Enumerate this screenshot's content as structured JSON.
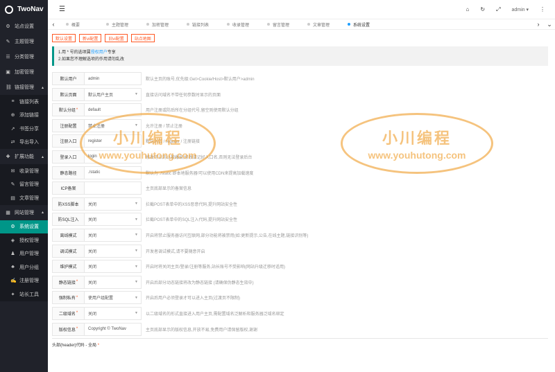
{
  "app": {
    "name": "TwoNav"
  },
  "header": {
    "user": "admin ▾"
  },
  "sidebar": {
    "items": [
      {
        "label": "站点设置",
        "icon": "gear-icon",
        "glyph": "⚙"
      },
      {
        "label": "主题管理",
        "icon": "brush-icon",
        "glyph": "✎"
      },
      {
        "label": "分类管理",
        "icon": "list-icon",
        "glyph": "☰"
      },
      {
        "label": "加密管理",
        "icon": "lock-icon",
        "glyph": "▣"
      },
      {
        "label": "链接管理",
        "icon": "link-icon",
        "glyph": "⛓"
      },
      {
        "label": "链接列表",
        "icon": "list-icon",
        "glyph": "≡"
      },
      {
        "label": "添加链接",
        "icon": "plus-icon",
        "glyph": "⊕"
      },
      {
        "label": "书签分享",
        "icon": "share-icon",
        "glyph": "↗"
      },
      {
        "label": "导出导入",
        "icon": "import-icon",
        "glyph": "⇄"
      },
      {
        "label": "扩展功能",
        "icon": "puzzle-icon",
        "glyph": "✚"
      },
      {
        "label": "收录管理",
        "icon": "inbox-icon",
        "glyph": "✉"
      },
      {
        "label": "留言管理",
        "icon": "message-icon",
        "glyph": "✎"
      },
      {
        "label": "文章管理",
        "icon": "document-icon",
        "glyph": "▤"
      },
      {
        "label": "网站管理",
        "icon": "site-icon",
        "glyph": "▦"
      },
      {
        "label": "系统设置",
        "icon": "settings-icon",
        "glyph": "⚙"
      },
      {
        "label": "授权管理",
        "icon": "key-icon",
        "glyph": "◈"
      },
      {
        "label": "用户管理",
        "icon": "user-icon",
        "glyph": "♟"
      },
      {
        "label": "用户分组",
        "icon": "group-icon",
        "glyph": "♣"
      },
      {
        "label": "注册管理",
        "icon": "register-icon",
        "glyph": "✍"
      },
      {
        "label": "站长工具",
        "icon": "tool-icon",
        "glyph": "✦"
      }
    ]
  },
  "tabs": [
    "概要",
    "主题管理",
    "加密管理",
    "链接列表",
    "收录管理",
    "留言管理",
    "文章管理",
    "系统设置"
  ],
  "buttons": {
    "default": "默认设置",
    "new": "新vi配置",
    "old": "旧vi配置",
    "export": "站点地图"
  },
  "notice": {
    "line1_prefix": "1.用 * 号的选项属",
    "line1_link": "授权用户",
    "line1_suffix": "专享",
    "line2": "2.如果您不理解选项的作用请勿乱改"
  },
  "rows": [
    {
      "label": "默认用户",
      "value": "admin",
      "select": false,
      "required": false,
      "desc": "默认主页的账号,优先级:Get>Cookie/Host>默认用户>admin"
    },
    {
      "label": "默认页面",
      "value": "默认用户主页",
      "select": true,
      "required": false,
      "desc": "直接访问域名不带任何参数时显示的页面"
    },
    {
      "label": "默认分组",
      "value": "default",
      "select": false,
      "required": true,
      "desc": "用户注册或防后所在分组代号,留空则使用默认分组"
    },
    {
      "label": "注册配置",
      "value": "禁止注册",
      "select": true,
      "required": false,
      "desc": "允许注册 / 禁止注册"
    },
    {
      "label": "注册入口",
      "value": "register",
      "select": false,
      "required": false,
      "desc": "默认入口 / register / 注册链接"
    },
    {
      "label": "登录入口",
      "value": "login",
      "select": false,
      "required": false,
      "desc": "修改可以防止被爆破,修改请记好入口名,否则无法登录后台"
    },
    {
      "label": "静态路径",
      "value": "./static",
      "select": false,
      "required": false,
      "desc": "默认为 ./static 即本地服务器!可以使用CDN来提高加载速度"
    },
    {
      "label": "ICP备案",
      "value": "",
      "select": false,
      "required": false,
      "desc": "主页底部显示的备案信息"
    },
    {
      "label": "防XSS脚本",
      "value": "关闭",
      "select": true,
      "required": false,
      "desc": "拦截POST表单中的XSS恶意代码,提升网站安全性"
    },
    {
      "label": "防SQL注入",
      "value": "关闭",
      "select": true,
      "required": false,
      "desc": "拦截POST表单中的SQL注入代码,提升网站安全性"
    },
    {
      "label": "离线模式",
      "value": "关闭",
      "select": true,
      "required": false,
      "desc": "开启将禁止服务器访问互联网,部分功能将被禁用(如:更新提示,公告,在线主题,链接识别等)"
    },
    {
      "label": "调试模式",
      "value": "关闭",
      "select": true,
      "required": false,
      "desc": "开发者调试模式,请不要随意开启"
    },
    {
      "label": "维护模式",
      "value": "关闭",
      "select": true,
      "required": false,
      "desc": "开启时将关闭主页/登录/注册等服务,站长账号不受影响(网站升级迁移时适用)"
    },
    {
      "label": "静态链接",
      "value": "关闭",
      "select": true,
      "required": true,
      "desc": "开启后部分动态链接将改为静态链接 (请确保伪静态生效中)"
    },
    {
      "label": "强制私有",
      "value": "使用户组配置",
      "select": true,
      "required": true,
      "desc": "开启后用户必须登录才可以进入主页(过渡页不限制)"
    },
    {
      "label": "二级域名",
      "value": "关闭",
      "select": true,
      "required": true,
      "desc": "以二级域名的形式直接进入用户主页,需配置域名泛解析和服务器泛域名绑定"
    },
    {
      "label": "版权信息",
      "value": "Copyright © TwoNav",
      "select": false,
      "required": true,
      "desc": "主页底部显示的版权信息,开放不易,免费用户请保留版权,谢谢"
    }
  ],
  "textarea": {
    "label": "头部(header)代码 - 全局"
  },
  "watermark": {
    "line1": "小川编程",
    "line2": "www.youhutong.com"
  },
  "colors": {
    "sidebar": "#20222a",
    "active": "#009688",
    "accent": "#ff5722",
    "link": "#1e9fff",
    "watermark": "#f0a030"
  }
}
